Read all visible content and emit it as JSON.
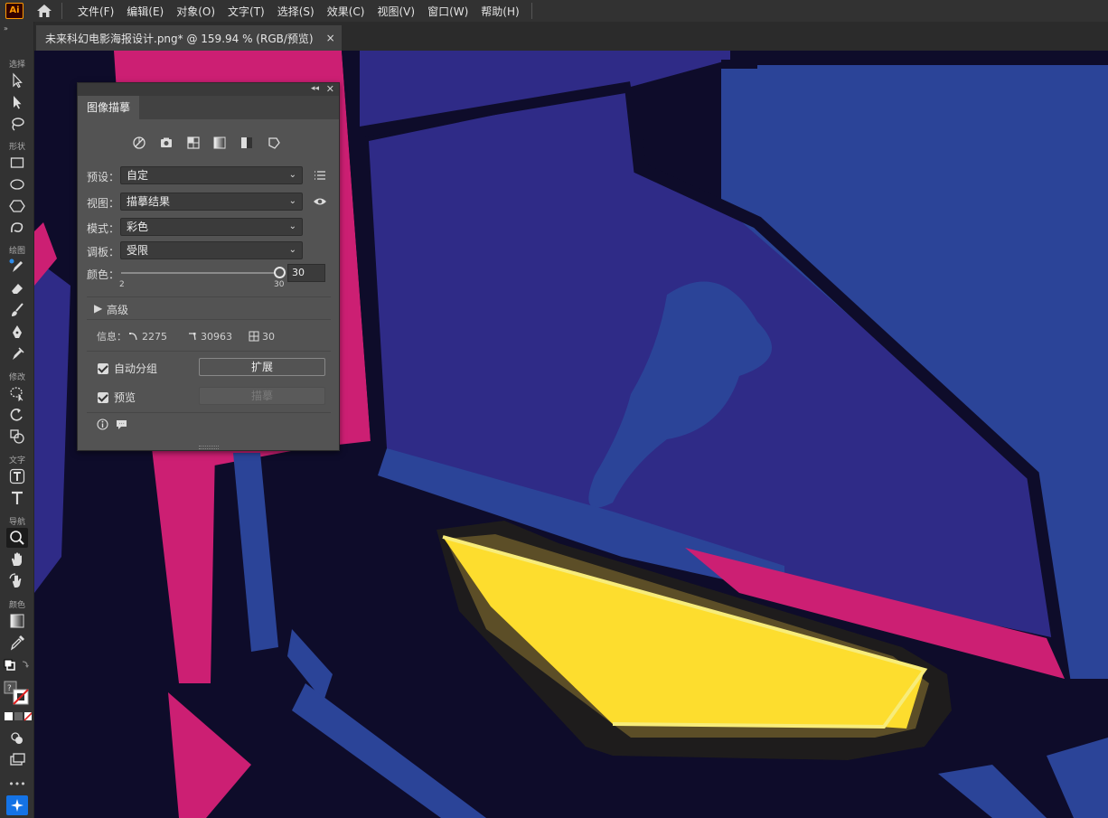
{
  "app": {
    "logo": "Ai",
    "home_icon": "home-icon"
  },
  "menu": [
    "文件(F)",
    "编辑(E)",
    "对象(O)",
    "文字(T)",
    "选择(S)",
    "效果(C)",
    "视图(V)",
    "窗口(W)",
    "帮助(H)"
  ],
  "document_tab": {
    "title": "未来科幻电影海报设计.png* @ 159.94 % (RGB/预览)",
    "close": "×"
  },
  "toolbar": {
    "sections": [
      "选择",
      "形状",
      "绘图",
      "修改",
      "文字",
      "导航",
      "颜色"
    ],
    "tools": [
      "selection-tool-icon",
      "direct-selection-tool-icon",
      "lasso-tool-icon",
      "rectangle-tool-icon",
      "ellipse-tool-icon",
      "polygon-tool-icon",
      "shaper-tool-icon",
      "pencil-tool-icon",
      "eraser-tool-icon",
      "paintbrush-tool-icon",
      "pen-tool-icon",
      "anchor-tool-icon",
      "puppet-warp-icon",
      "rotate-tool-icon",
      "shape-builder-icon",
      "touch-type-icon",
      "type-tool-icon",
      "zoom-tool-icon",
      "hand-tool-icon",
      "rotate-view-icon",
      "gradient-tool-icon",
      "eyedropper-tool-icon"
    ],
    "more": "•••"
  },
  "panel": {
    "tab": "图像描摹",
    "preset_icons": [
      "auto-color-icon",
      "high-color-icon",
      "low-color-icon",
      "grayscale-icon",
      "black-white-icon",
      "outline-icon"
    ],
    "preset": {
      "label": "预设：",
      "value": "自定"
    },
    "view": {
      "label": "视图：",
      "value": "描摹结果"
    },
    "mode": {
      "label": "模式：",
      "value": "彩色"
    },
    "palette": {
      "label": "调板：",
      "value": "受限"
    },
    "colors": {
      "label": "颜色：",
      "value": "30",
      "min": "2",
      "max": "30",
      "level": 1.0
    },
    "advanced": "高级",
    "info": {
      "label": "信息：",
      "paths": "2275",
      "anchors": "30963",
      "colors": "30"
    },
    "auto_group": {
      "label": "自动分组",
      "checked": true
    },
    "expand_button": "扩展",
    "preview": {
      "label": "预览",
      "checked": true
    },
    "trace_button": "描摹"
  },
  "colors": {
    "canvas_dark": "#0e0c2a",
    "purple_blue": "#2f2b87",
    "royal_blue": "#2b4498",
    "magenta": "#cc1f73",
    "yellow": "#fddd2e",
    "panel_bg": "#535353"
  }
}
